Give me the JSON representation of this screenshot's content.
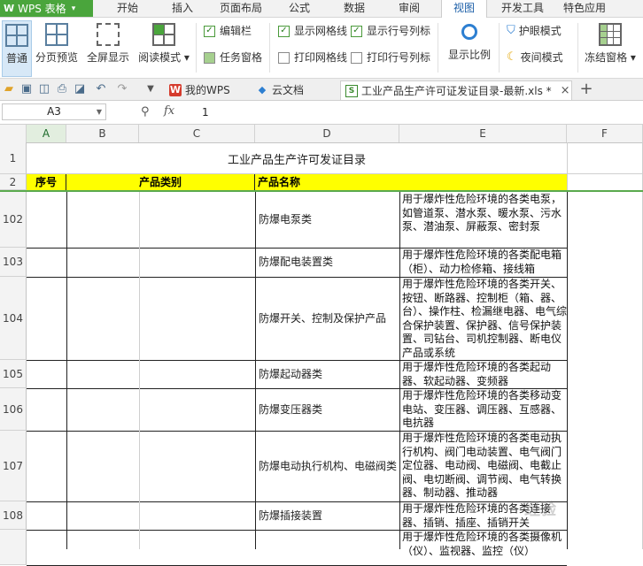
{
  "app": {
    "logo": "W",
    "name": "WPS 表格",
    "caret": "▾"
  },
  "menu": [
    {
      "label": "开始"
    },
    {
      "label": "插入"
    },
    {
      "label": "页面布局"
    },
    {
      "label": "公式"
    },
    {
      "label": "数据"
    },
    {
      "label": "审阅"
    },
    {
      "label": "视图",
      "active": true
    },
    {
      "label": "开发工具"
    },
    {
      "label": "特色应用"
    }
  ],
  "ribbon": {
    "normal": "普通",
    "page_break": "分页预览",
    "full_screen": "全屏显示",
    "read_mode": "阅读模式 ▾",
    "edit_bar": "编辑栏",
    "task_pane": "任务窗格",
    "show_gridlines": "显示网格线",
    "print_gridlines": "打印网格线",
    "show_headings": "显示行号列标",
    "print_headings": "打印行号列标",
    "zoom": "显示比例",
    "eye_protect": "护眼模式",
    "night_mode": "夜间模式",
    "freeze": "冻结窗格 ▾"
  },
  "tabs": {
    "my_wps": "我的WPS",
    "cloud_doc": "云文档",
    "active_file": "工业产品生产许可证发证目录-最新.xls *",
    "add": "+"
  },
  "formula": {
    "cell_ref": "A3",
    "fx": "fx",
    "value": "1"
  },
  "columns": [
    "A",
    "B",
    "C",
    "D",
    "E",
    "F"
  ],
  "sheet": {
    "title": "工业产品生产许可发证目录",
    "title_row": "1",
    "header_row": "2",
    "headers": {
      "seq": "序号",
      "category": "产品类别",
      "product": "产品名称"
    },
    "rows": [
      {
        "num": "102",
        "name": "防爆电泵类",
        "desc": "用于爆炸性危险环境的各类电泵，如管道泵、潜水泵、暖水泵、污水泵、潜油泵、屏蔽泵、密封泵"
      },
      {
        "num": "103",
        "name": "防爆配电装置类",
        "desc": "用于爆炸性危险环境的各类配电箱（柜）、动力检修箱、接线箱"
      },
      {
        "num": "104",
        "name": "防爆开关、控制及保护产品",
        "desc": "用于爆炸性危险环境的各类开关、按钮、断路器、控制柜（箱、器、台）、操作柱、检漏继电器、电气综合保护装置、保护器、信号保护装置、司钻台、司机控制器、断电仪产品或系统"
      },
      {
        "num": "105",
        "name": "防爆起动器类",
        "desc": "用于爆炸性危险环境的各类起动器、软起动器、变频器"
      },
      {
        "num": "106",
        "name": "防爆变压器类",
        "desc": "用于爆炸性危险环境的各类移动变电站、变压器、调压器、互感器、电抗器"
      },
      {
        "num": "107",
        "name": "防爆电动执行机构、电磁阀类",
        "desc": "用于爆炸性危险环境的各类电动执行机构、阀门电动装置、电气阀门定位器、电动阀、电磁阀、电截止阀、电切断阀、调节阀、电气转换器、制动器、推动器"
      },
      {
        "num": "108",
        "name": "防爆插接装置",
        "desc": "用于爆炸性危险环境的各类连接器、插销、插座、插销开关"
      },
      {
        "num": "",
        "name": "",
        "desc": "用于爆炸性危险环境的各类摄像机（仪）、监视器、监控（仪）"
      }
    ]
  },
  "watermark": "经验"
}
